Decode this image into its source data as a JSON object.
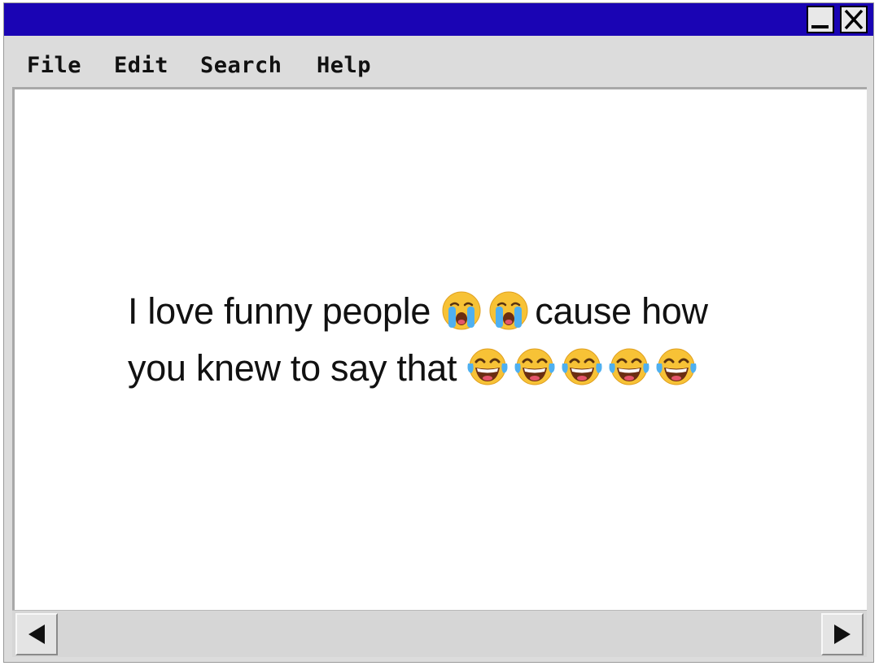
{
  "window": {
    "title": ""
  },
  "titlebar": {
    "minimize_icon": "minimize-icon",
    "close_icon": "close-icon",
    "color": "#1a04b4"
  },
  "menu": {
    "items": [
      {
        "label": "File"
      },
      {
        "label": "Edit"
      },
      {
        "label": "Search"
      },
      {
        "label": "Help"
      }
    ]
  },
  "document": {
    "segments": [
      {
        "text": "I love funny people "
      },
      {
        "emoji": "loudly-crying-face",
        "char": "😭"
      },
      {
        "emoji": "loudly-crying-face",
        "char": "😭"
      },
      {
        "text": "cause how you knew to say that "
      },
      {
        "emoji": "face-with-tears-of-joy",
        "char": "😂"
      },
      {
        "emoji": "face-with-tears-of-joy",
        "char": "😂"
      },
      {
        "emoji": "face-with-tears-of-joy",
        "char": "😂"
      },
      {
        "emoji": "face-with-tears-of-joy",
        "char": "😂"
      },
      {
        "emoji": "face-with-tears-of-joy",
        "char": "😂"
      }
    ]
  },
  "scrollbar": {
    "left_icon": "arrow-left-icon",
    "right_icon": "arrow-right-icon"
  }
}
